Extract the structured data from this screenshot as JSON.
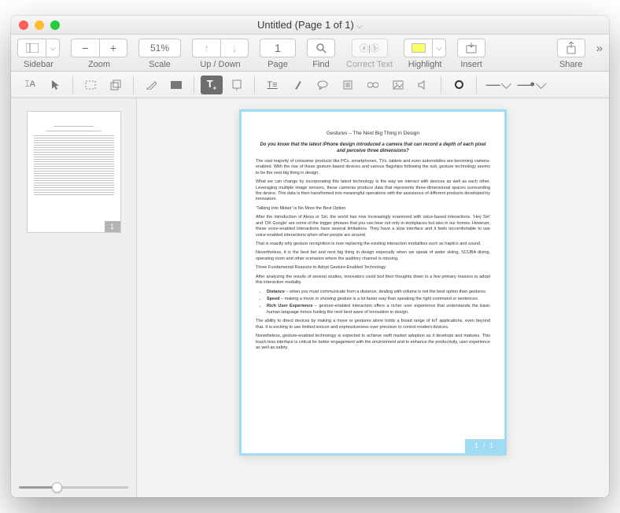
{
  "window": {
    "title": "Untitled (Page 1 of 1)"
  },
  "toolbar": {
    "sidebar": "Sidebar",
    "zoom": "Zoom",
    "zoom_minus": "−",
    "zoom_plus": "+",
    "zoom_value": "51%",
    "scale": "Scale",
    "updown": "Up / Down",
    "page_value": "1",
    "page": "Page",
    "find": "Find",
    "correct": "Correct Text",
    "highlight": "Highlight",
    "insert": "Insert",
    "share": "Share"
  },
  "sidebar": {
    "thumb_page": "1",
    "slider_pct": 30
  },
  "canvas": {
    "page_indicator": "1 / 1"
  },
  "doc": {
    "title": "Gestures – The Next Big Thing in Design",
    "lead": "Do you know that the latest iPhone design introduced a camera that can record a depth of each pixel and perceive three dimensions?",
    "p1": "The vast majority of consumer products like PCs, smartphones, TVs, tablets and even automobiles are becoming camera-enabled. With the rise of these gesture-based devices and various flagships following the suit, gesture technology seems to be the next big thing in design.",
    "p2": "What we can change by incorporating this latest technology is the way we interact with devices as well as each other. Leveraging multiple image sensors, these cameras produce data that represents three-dimensional spaces surrounding the device. This data is then transformed into meaningful operations with the assistance of different products developed by innovators.",
    "p3h": "‘Talking Into Midair’ is No More the Best Option",
    "p3": "After the introduction of Alexa or Siri, the world has now increasingly enamored with voice-based interactions. ‘Hey Siri’ and ‘OK Google’ are some of the trigger phrases that you can hear not only in workplaces but also in our homes. However, these voice-enabled interactions have several limitations. They have a slow interface and it feels uncomfortable to use voice-enabled interactions when other people are around.",
    "p4": "That is exactly why gesture recognition is now replacing the existing interaction modalities such as haptics and sound.",
    "p5": "Nevertheless, it is the best bet and next big thing in design especially when we speak of water skiing, SCUBA diving, operating room and other scenarios where the auditory channel is missing.",
    "p6h": "Three Fundamental Reasons to Adopt Gesture-Enabled Technology",
    "p6": "After analyzing the results of several studies, innovators could boil their thoughts down to a few primary reasons to adopt this interaction modality.",
    "b1t": "Distance",
    "b1": " – when you must communicate from a distance, dealing with volume is not the best option than gestures.",
    "b2t": "Speed",
    "b2": " – making a move or showing gesture is a lot faster way than speaking the right command or sentences.",
    "b3t": "Rich User Experience",
    "b3": " – gesture-enabled interaction offers a richer user experience that understands the basic human language hence fueling the next best wave of innovation in design.",
    "p7": "The ability to direct devices by making a move or gestures alone holds a broad range of IoT applications, even beyond that. It is exciting to use limited lexicon and expressiveness over precision to control modern devices.",
    "p8": "Nonetheless, gesture-enabled technology is expected to achieve swift market adoption as it develops and matures. This touch-less interface is critical for better engagement with the environment and to enhance the productivity, user experience as well as safety."
  }
}
